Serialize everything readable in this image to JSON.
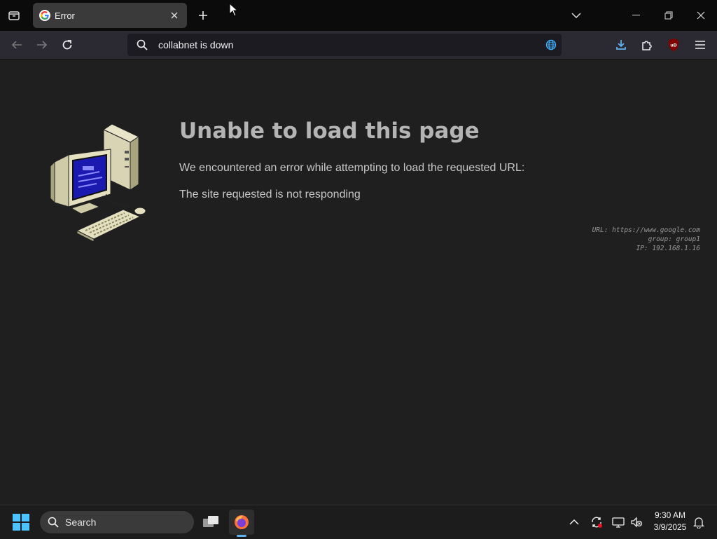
{
  "browser": {
    "tab": {
      "title": "Error",
      "favicon": "google-g-icon"
    },
    "address_bar": {
      "value": "collabnet is down"
    },
    "icons": {
      "tab_list": "tab-list-icon",
      "new_tab": "plus-icon",
      "list_all_tabs": "chevron-down-icon",
      "minimize": "minimize-icon",
      "maximize": "restore-icon",
      "close": "close-icon",
      "back": "back-arrow-icon",
      "forward": "forward-arrow-icon",
      "reload": "reload-icon",
      "downloads": "download-icon",
      "extensions": "puzzle-icon",
      "ublock": "ublock-icon",
      "menu": "hamburger-icon"
    },
    "accent_color": "#5fb3f0"
  },
  "page": {
    "title": "Unable to load this page",
    "line1": "We encountered an error while attempting to load the requested URL:",
    "line2": "The site requested is not responding",
    "meta": {
      "url": "URL: https://www.google.com",
      "group": "group: group1",
      "ip": "IP: 192.168.1.16"
    }
  },
  "taskbar": {
    "search_label": "Search",
    "time": "9:30 AM",
    "date": "3/9/2025",
    "apps": [
      "task-view-icon",
      "firefox-icon"
    ],
    "tray_icons": [
      "chevron-up-icon",
      "sync-icon",
      "network-icon",
      "volume-muted-icon",
      "notification-bell-icon"
    ]
  }
}
